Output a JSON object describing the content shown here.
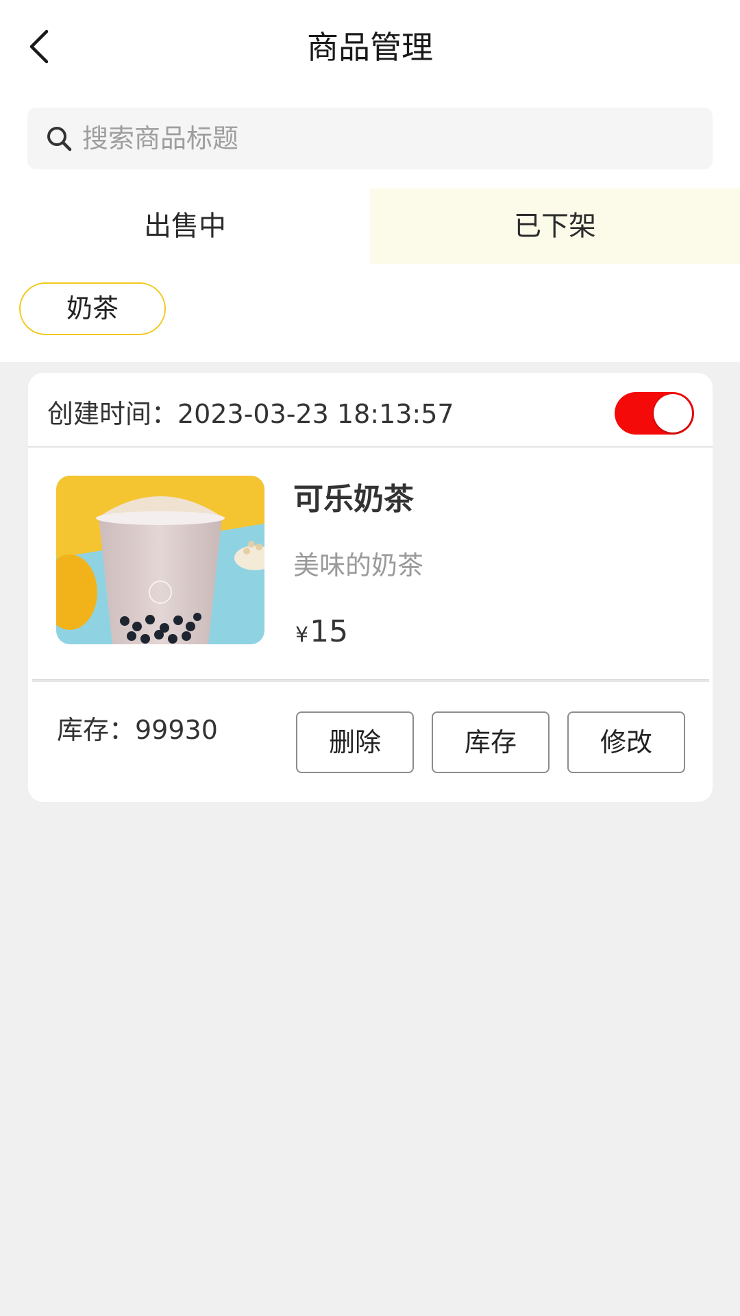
{
  "header": {
    "title": "商品管理",
    "back_icon": "chevron-left-icon"
  },
  "search": {
    "placeholder": "搜索商品标题",
    "icon": "search-icon"
  },
  "tabs": [
    {
      "label": "出售中",
      "active": true
    },
    {
      "label": "已下架",
      "active": false
    }
  ],
  "category_chip": {
    "label": "奶茶"
  },
  "product": {
    "created_label": "创建时间：2023-03-23 18:13:57",
    "listed_toggle_on": true,
    "name": "可乐奶茶",
    "description": "美味的奶茶",
    "currency": "¥",
    "price": "15",
    "stock_label": "库存：99930",
    "image": "milk-tea-product-photo"
  },
  "actions": {
    "delete_label": "删除",
    "stock_label": "库存",
    "edit_label": "修改"
  },
  "colors": {
    "accent_yellow": "#f2c81e",
    "inactive_tab_bg": "#fcfbea",
    "toggle_on": "#f50a0a",
    "page_bg": "#f0f0f0"
  }
}
